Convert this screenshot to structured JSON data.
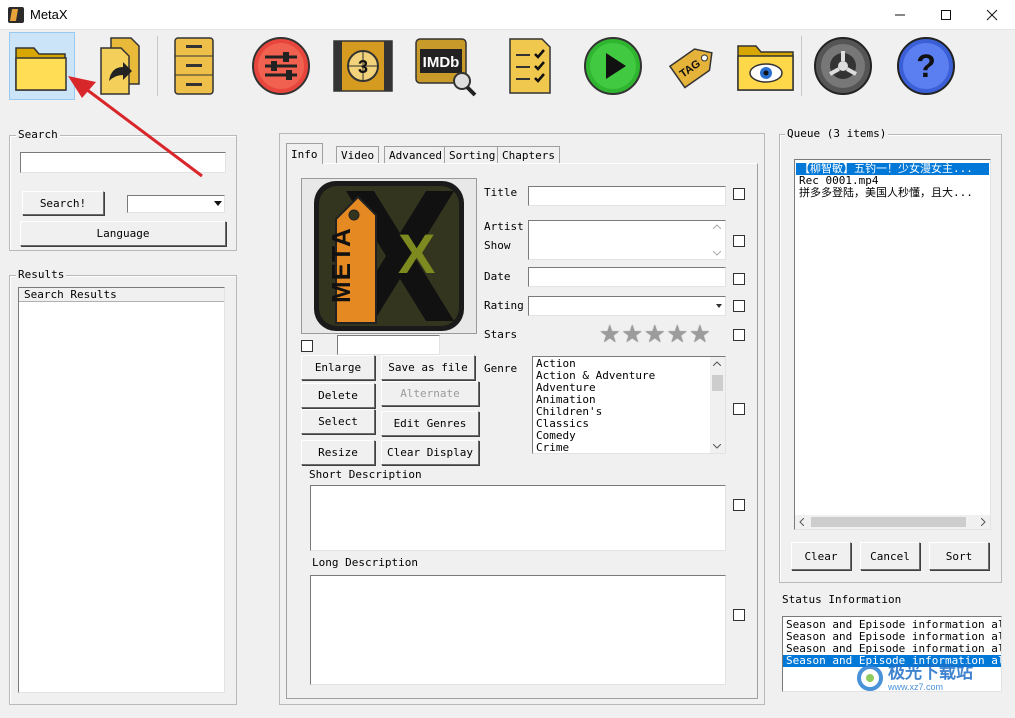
{
  "window": {
    "title": "MetaX",
    "minimize": "—",
    "maximize": "☐",
    "close": "✕"
  },
  "search": {
    "group_label": "Search",
    "search_button": "Search!",
    "language_button": "Language"
  },
  "results": {
    "group_label": "Results",
    "header": "Search Results"
  },
  "tabs": [
    {
      "label": "Info"
    },
    {
      "label": "Video"
    },
    {
      "label": "Advanced"
    },
    {
      "label": "Sorting"
    },
    {
      "label": "Chapters"
    }
  ],
  "info": {
    "title_label": "Title",
    "artist_label": "Artist",
    "show_label": "Show",
    "date_label": "Date",
    "rating_label": "Rating",
    "stars_label": "Stars",
    "genre_label": "Genre",
    "short_desc_label": "Short Description",
    "long_desc_label": "Long Description",
    "stars_value": 0,
    "genres": [
      "Action",
      "Action & Adventure",
      "Adventure",
      "Animation",
      "Children's",
      "Classics",
      "Comedy",
      "Crime"
    ]
  },
  "art_buttons": {
    "enlarge": "Enlarge",
    "save_as_file": "Save as file",
    "delete": "Delete",
    "alternate": "Alternate",
    "select": "Select",
    "edit_genres": "Edit Genres",
    "resize": "Resize",
    "clear_display": "Clear Display"
  },
  "artwork": {
    "logo_word": "META",
    "logo_letter": "X"
  },
  "queue": {
    "group_label": "Queue (3 items)",
    "items": [
      "【柳智敏】五钓一！少女漫女主...",
      "Rec 0001.mp4",
      "拼多多登陆，美国人秒懂，且大..."
    ],
    "clear_button": "Clear",
    "cancel_button": "Cancel",
    "sort_button": "Sort"
  },
  "status": {
    "label": "Status Information",
    "lines": [
      "Season and Episode information already",
      "Season and Episode information already",
      "Season and Episode information already",
      "Season and Episode information already"
    ]
  },
  "toolbar_icons": [
    "open-folder-icon",
    "copy-files-icon",
    "file-cabinet-icon",
    "settings-sliders-icon",
    "film-countdown-icon",
    "imdb-search-icon",
    "checklist-icon",
    "play-icon",
    "auto-tag-icon",
    "view-folder-icon",
    "film-reel-icon",
    "help-icon"
  ],
  "watermark": {
    "text": "极光下载站",
    "url": "www.xz7.com"
  },
  "colors": {
    "selection": "#0078d7",
    "arrow": "#d9262b"
  }
}
